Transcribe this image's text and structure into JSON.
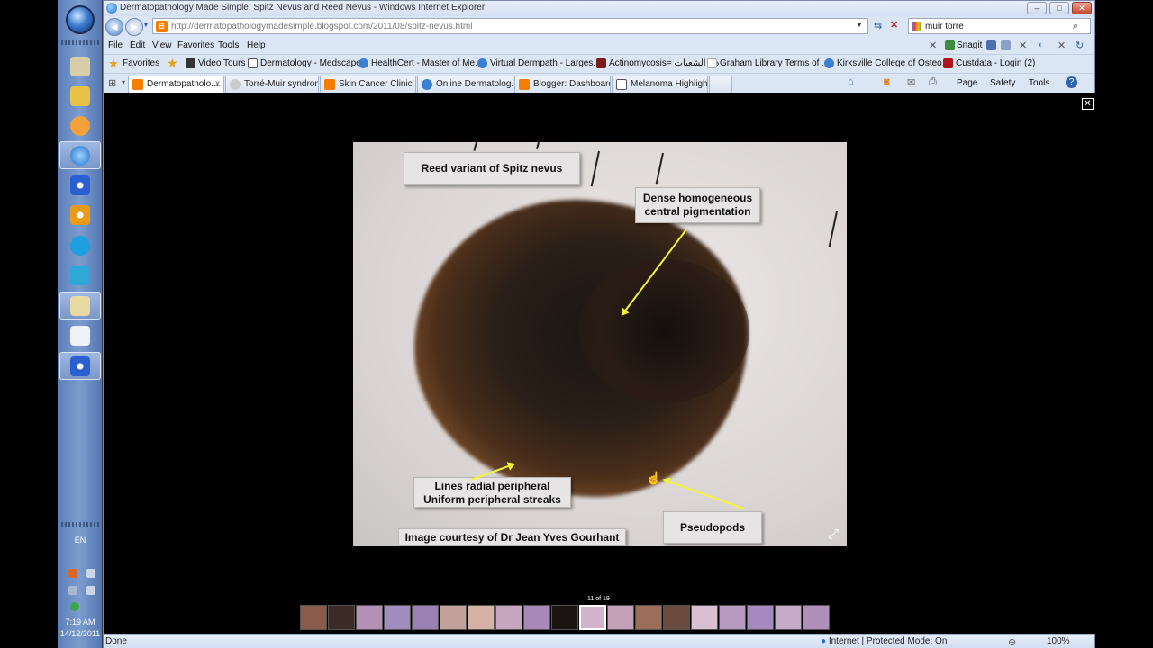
{
  "window": {
    "title": "Dermatopathology Made Simple: Spitz Nevus and Reed Nevus - Windows Internet Explorer",
    "minimize": "–",
    "maximize": "□",
    "close": "✕"
  },
  "address": {
    "url": "http://dermatopathologymadesimple.blogspot.com/2011/08/spitz-nevus.html"
  },
  "search": {
    "value": "muir torre"
  },
  "menu": {
    "items": [
      "File",
      "Edit",
      "View",
      "Favorites",
      "Tools",
      "Help"
    ],
    "snagit": "Snagit"
  },
  "favorites": {
    "label": "Favorites",
    "items": [
      "Video Tours",
      "Dermatology - Medscape",
      "HealthCert - Master of Me...",
      "Virtual Dermpath - Larges...",
      "Actinomycosis= داء الشعيات",
      "Graham Library Terms of ...",
      "Kirksville College of Osteo...",
      "Custdata - Login (2)"
    ]
  },
  "tabs": [
    {
      "label": "Dermatopatholo...",
      "close": "x"
    },
    {
      "label": "Torré-Muir syndrom..."
    },
    {
      "label": "Skin Cancer Clinic"
    },
    {
      "label": "Online Dermatolog..."
    },
    {
      "label": "Blogger: Dashboard"
    },
    {
      "label": "Melanoma Highligh..."
    }
  ],
  "command_bar": {
    "page": "Page",
    "safety": "Safety",
    "tools": "Tools"
  },
  "lightbox": {
    "close": "✕",
    "counter": "11 of 19",
    "labels": {
      "title": "Reed variant of Spitz nevus",
      "central_1": "Dense homogeneous",
      "central_2": "central pigmentation",
      "lines_1": "Lines radial peripheral",
      "lines_2": "Uniform peripheral streaks",
      "pseudopods": "Pseudopods",
      "courtesy": "Image courtesy of Dr Jean Yves Gourhant"
    },
    "thumbnails_count": 19,
    "selected_thumbnail": 11
  },
  "status": {
    "done": "Done",
    "zone": "Internet | Protected Mode: On",
    "zoom": "100%"
  },
  "taskbar": {
    "language": "EN",
    "time": "7:19 AM",
    "date": "14/12/2011"
  },
  "colors": {
    "annotation_arrow": "#f2f237",
    "blogger_orange": "#f57d00"
  }
}
